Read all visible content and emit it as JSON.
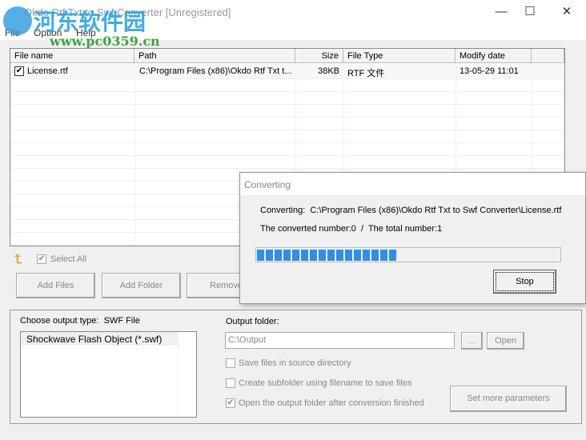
{
  "window": {
    "title": "Okdo Rtf Txt to Swf Converter [Unregistered]",
    "minimize": "—",
    "maximize": "☐",
    "close": "✕"
  },
  "menu": [
    "File",
    "Option",
    "Help"
  ],
  "watermark": {
    "text": "河东软件园",
    "url": "www.pc0359.cn"
  },
  "table": {
    "columns": [
      "File name",
      "Path",
      "Size",
      "File Type",
      "Modify date"
    ],
    "rows": [
      {
        "checked": true,
        "name": "License.rtf",
        "path": "C:\\Program Files (x86)\\Okdo Rtf Txt t...",
        "size": "38KB",
        "type": "RTF 文件",
        "date": "13-05-29 11:01"
      }
    ]
  },
  "select_all": {
    "label": "Select All",
    "checked": true
  },
  "buttons": {
    "add_files": "Add Files",
    "add_folder": "Add Folder",
    "remove": "Remove"
  },
  "output": {
    "type_label": "Choose output type:",
    "type_value": "SWF File",
    "formats": [
      "Shockwave Flash Object (*.swf)"
    ],
    "folder_label": "Output folder:",
    "folder_value": "C:\\Output",
    "browse": "...",
    "open": "Open",
    "options": [
      {
        "label": "Save files in source directory",
        "checked": false
      },
      {
        "label": "Create subfolder using filename to save files",
        "checked": false
      },
      {
        "label": "Open the output folder after conversion finished",
        "checked": true
      }
    ],
    "more_params": "Set more parameters"
  },
  "dialog": {
    "title": "Converting",
    "converting_label": "Converting:",
    "converting_path": "C:\\Program Files (x86)\\Okdo Rtf Txt to Swf Converter\\License.rtf",
    "count_text": "The converted number:0  /  The total number:1",
    "progress_percent": 46,
    "stop": "Stop",
    "accent": "#2e8fe8"
  }
}
